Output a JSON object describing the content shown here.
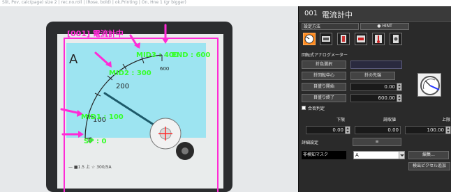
{
  "top_bar": {
    "text": "Slit, Pov, calc(page) size 2 | rec.no.roll | (Rose, bold) | ok.Printing | On, Hne 1 (gr bigger)"
  },
  "overlay": {
    "title": "[001] 電流計中",
    "labels": {
      "mid3": "MID3 : 400",
      "end": "END : 600",
      "mid2": "MID2 : 300",
      "mid1": "MID1 : 100",
      "sp": "SP : 0"
    }
  },
  "meter": {
    "unit": "A",
    "ticks": [
      "600",
      "200",
      "100",
      "0"
    ],
    "footer": "— ■1.5 上 ☆ 300/5A"
  },
  "panel": {
    "header": {
      "number": "001",
      "title": "電流計中"
    },
    "setting_method_label": "設定方法",
    "hint_label": "HINT",
    "section_title": "回転式アナログメーター",
    "needle_select_label": "針色選択",
    "rotation_center_label": "針回転中心",
    "needle_tip_label": "針の先端",
    "scale_start_label": "目盛り開始",
    "scale_start_value": "0.00",
    "scale_end_label": "目盛り終了",
    "scale_end_value": "600.00",
    "pass_fail_label": "合否判定",
    "columns": [
      "下限",
      "読取値",
      "上限"
    ],
    "lower_value": "0.00",
    "read_value": "0.00",
    "upper_value": "100.00",
    "detail_settings_label": "詳細設定",
    "detail_settings_button": "≡",
    "nontarget_mask_label": "非検知マスク",
    "mask_select_value": "A",
    "edit_button": "編集...",
    "add_pixel_button": "検出ピクセル追加"
  },
  "colors": {
    "overlay_magenta": "#ff2bd6",
    "label_green": "#35ff2a",
    "roi_cyan": "#8fe3f2",
    "selected_icon": "#ff8a1e",
    "panel_bg": "#2a2a2a"
  }
}
